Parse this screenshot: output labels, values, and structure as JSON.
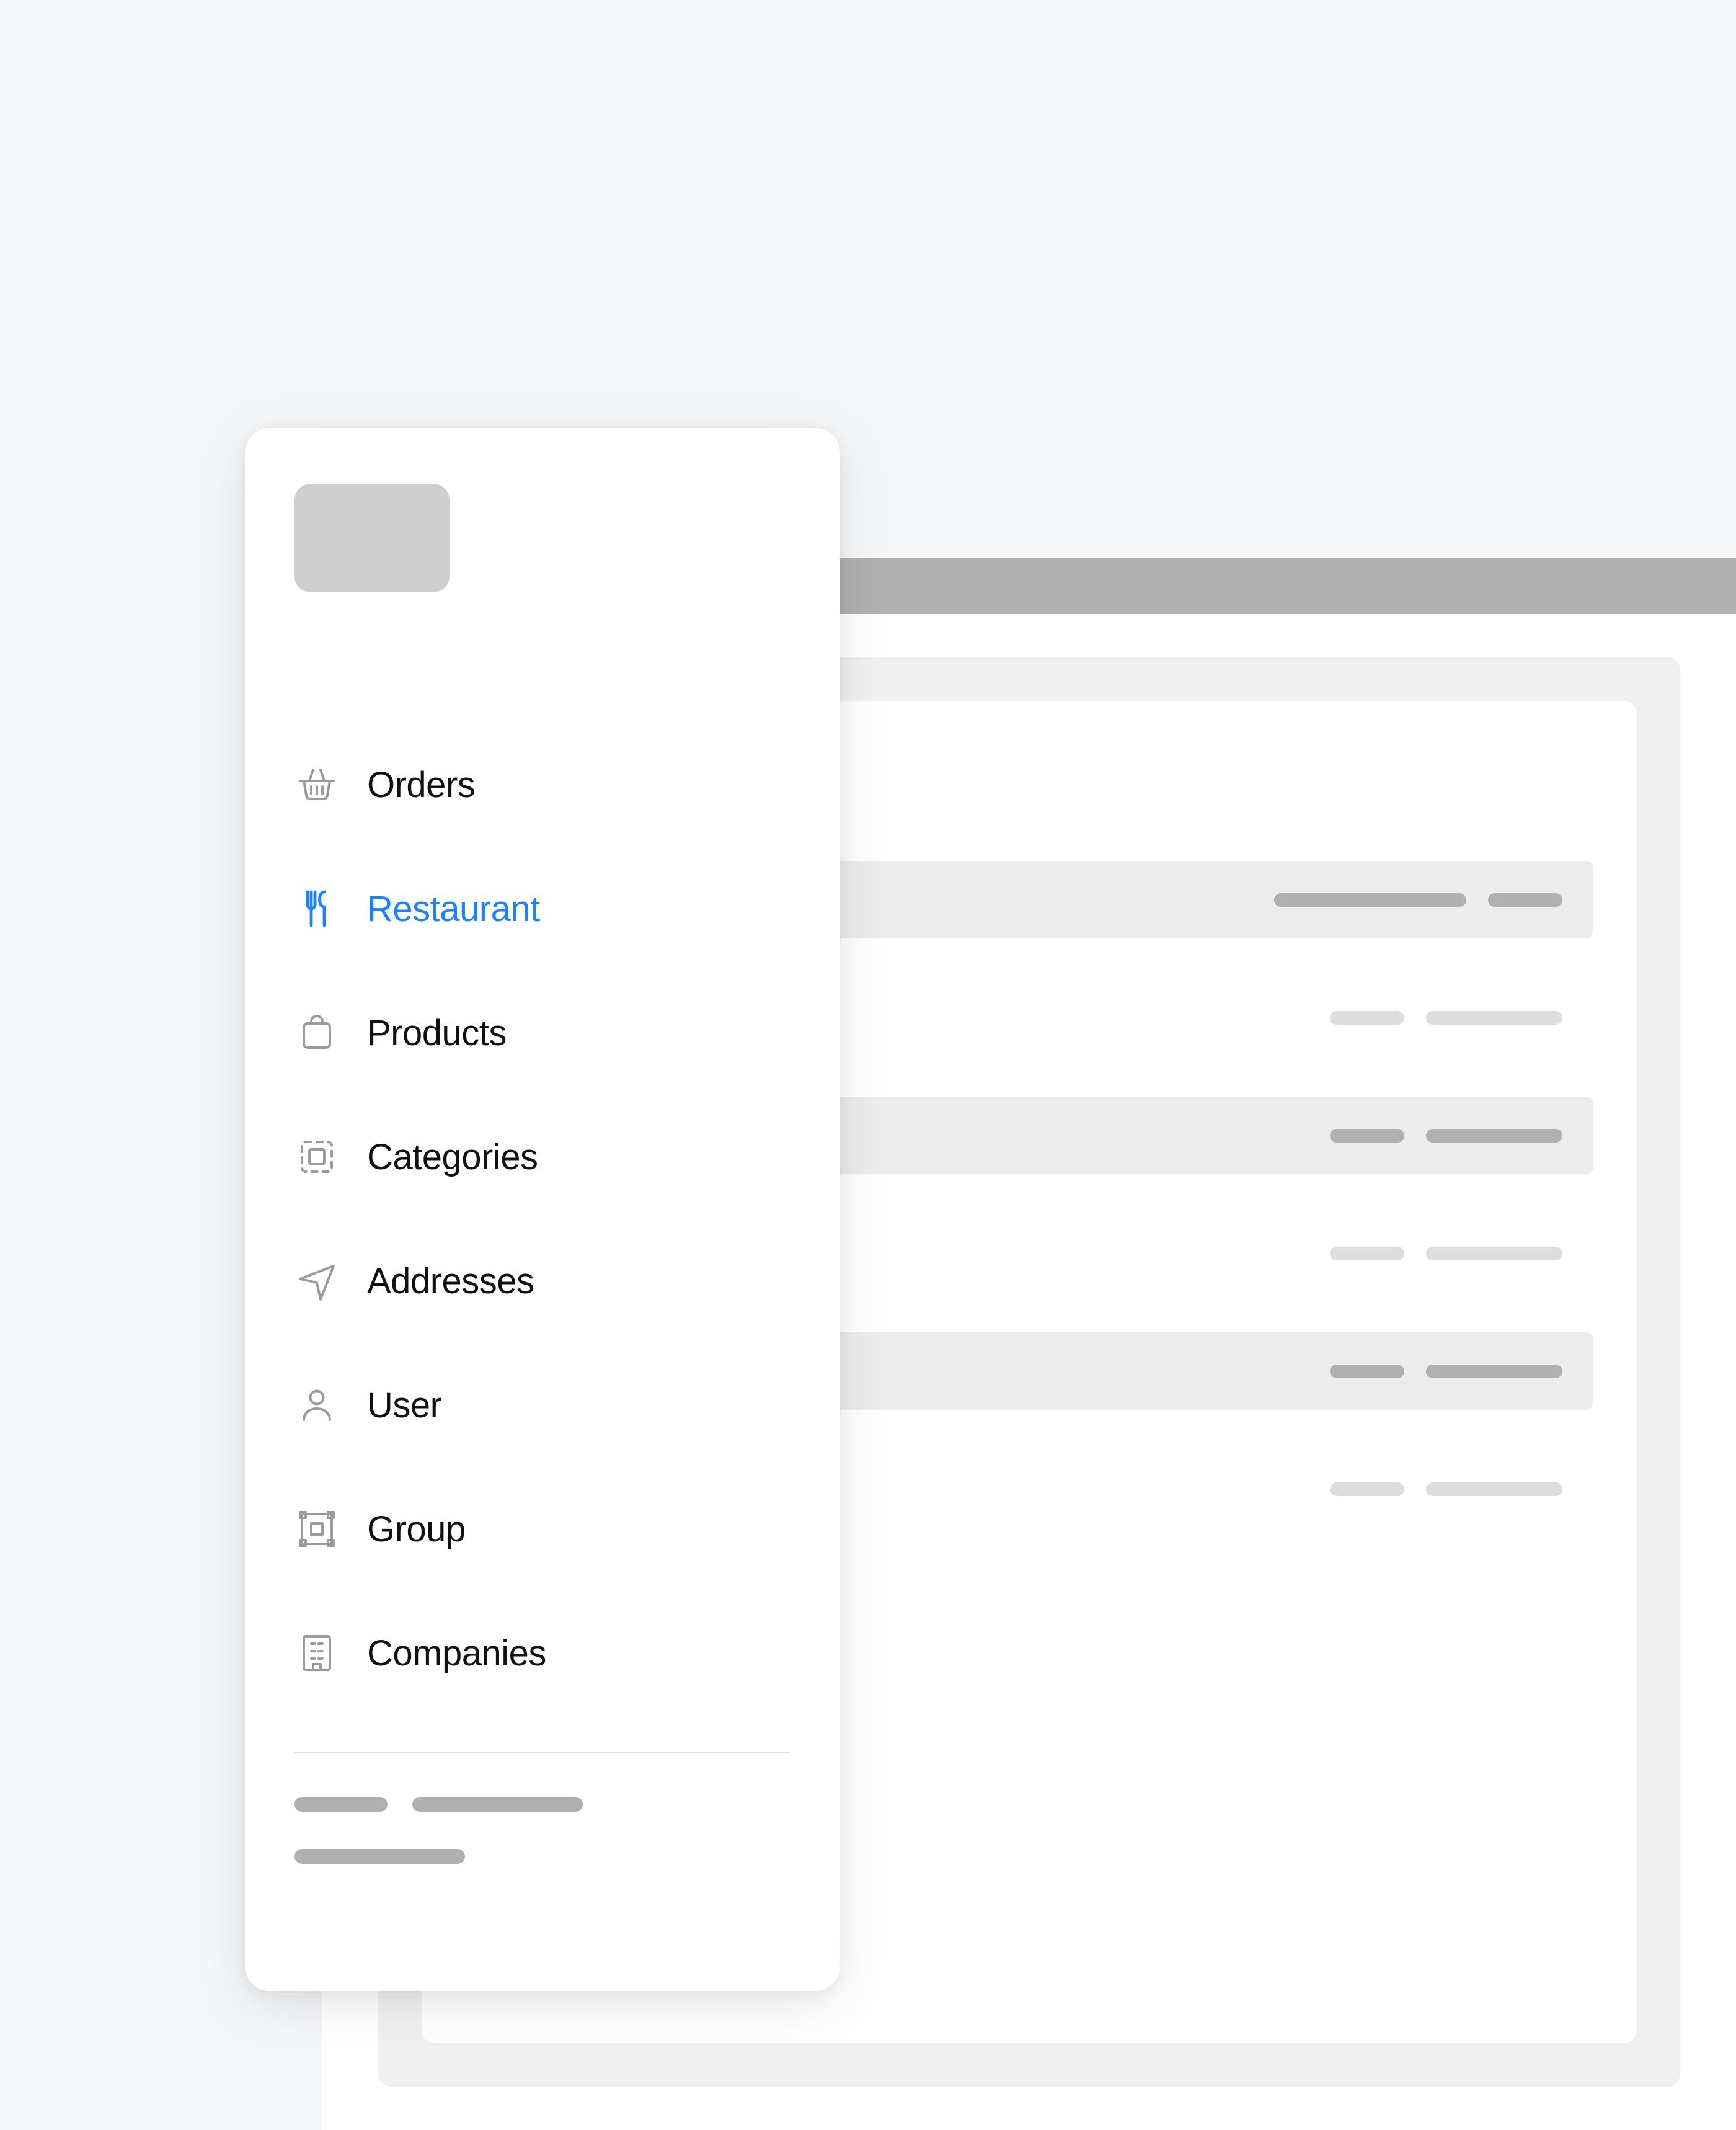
{
  "colors": {
    "accent": "#1a82ff",
    "page_bg": "#f5f6f8",
    "panel_bg": "#ffffff",
    "placeholder_dark": "#b0b0b0",
    "placeholder_light": "#dddddd",
    "icon_muted": "#9a9a9a"
  },
  "sidebar": {
    "active_key": "restaurant",
    "items": [
      {
        "key": "orders",
        "label": "Orders",
        "icon": "basket-icon",
        "active": false
      },
      {
        "key": "restaurant",
        "label": "Restaurant",
        "icon": "utensils-icon",
        "active": true
      },
      {
        "key": "products",
        "label": "Products",
        "icon": "bag-icon",
        "active": false
      },
      {
        "key": "categories",
        "label": "Categories",
        "icon": "dashed-box-icon",
        "active": false
      },
      {
        "key": "addresses",
        "label": "Addresses",
        "icon": "compass-icon",
        "active": false
      },
      {
        "key": "user",
        "label": "User",
        "icon": "user-icon",
        "active": false
      },
      {
        "key": "group",
        "label": "Group",
        "icon": "group-frame-icon",
        "active": false
      },
      {
        "key": "companies",
        "label": "Companies",
        "icon": "building-icon",
        "active": false
      }
    ]
  }
}
